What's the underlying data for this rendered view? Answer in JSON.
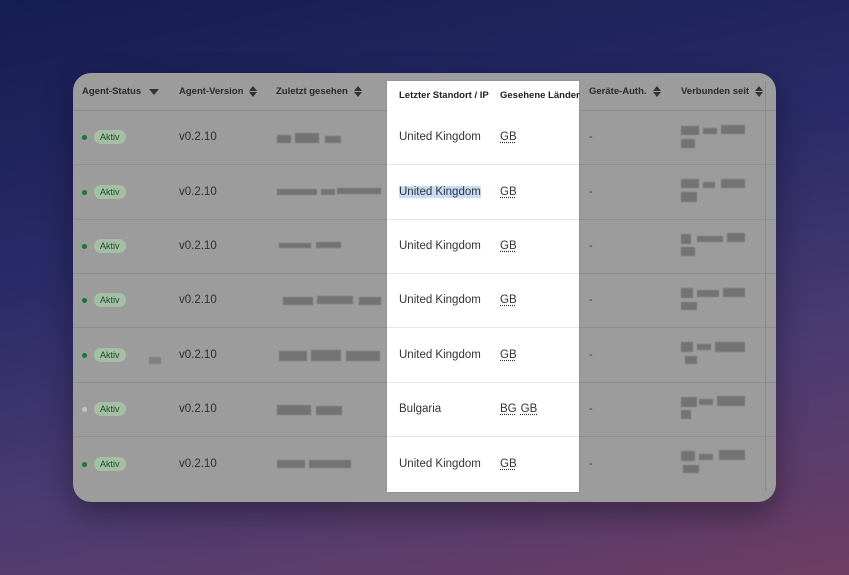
{
  "table": {
    "headers": {
      "agent_status": "Agent-Status",
      "agent_version": "Agent-Version",
      "last_seen": "Zuletzt gesehen",
      "last_location": "Letzter Standort / IP",
      "countries_seen": "Gesehene Länder",
      "device_auth": "Geräte-Auth.",
      "connected_since": "Verbunden seit"
    },
    "rows": [
      {
        "status": "Aktiv",
        "version": "v0.2.10",
        "location": "United Kingdom",
        "countries": [
          "GB"
        ],
        "device_auth": "-"
      },
      {
        "status": "Aktiv",
        "version": "v0.2.10",
        "location": "United Kingdom",
        "countries": [
          "GB"
        ],
        "device_auth": "-"
      },
      {
        "status": "Aktiv",
        "version": "v0.2.10",
        "location": "United Kingdom",
        "countries": [
          "GB"
        ],
        "device_auth": "-"
      },
      {
        "status": "Aktiv",
        "version": "v0.2.10",
        "location": "United Kingdom",
        "countries": [
          "GB"
        ],
        "device_auth": "-"
      },
      {
        "status": "Aktiv",
        "version": "v0.2.10",
        "location": "United Kingdom",
        "countries": [
          "GB"
        ],
        "device_auth": "-"
      },
      {
        "status": "Aktiv",
        "version": "v0.2.10",
        "location": "Bulgaria",
        "countries": [
          "BG",
          "GB"
        ],
        "device_auth": "-"
      },
      {
        "status": "Aktiv",
        "version": "v0.2.10",
        "location": "United Kingdom",
        "countries": [
          "GB"
        ],
        "device_auth": "-"
      }
    ]
  },
  "colors": {
    "active_dot": "#157a2c",
    "inactive_dot": "#c2c2c2",
    "badge_bg": "#a4bfa6",
    "highlight_column_bg": "#ffffff",
    "selection": "#c7dcf6"
  },
  "icons": {
    "sort": "sort-updown-icon",
    "sort_desc": "sort-desc-icon",
    "status_dot": "status-dot-icon"
  }
}
